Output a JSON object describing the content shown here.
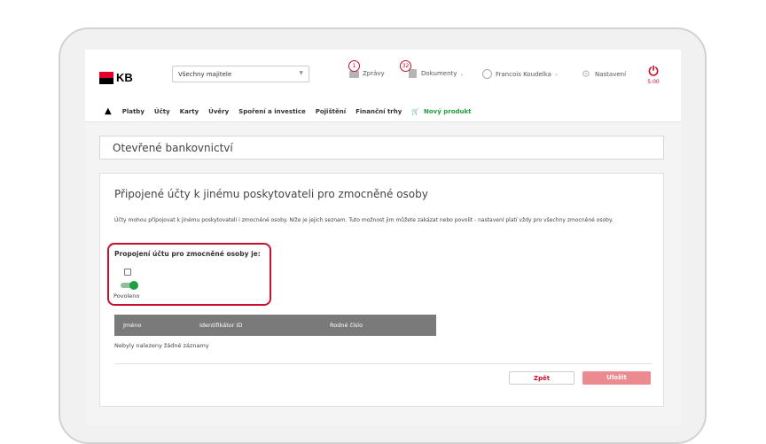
{
  "header": {
    "logo_text": "KB",
    "owner_select": {
      "value": "Všechny majitele"
    },
    "messages": {
      "label": "Zprávy",
      "badge": "1"
    },
    "documents": {
      "label": "Dokumenty",
      "badge": "32"
    },
    "user": {
      "label": "Francois Koudelka"
    },
    "settings": {
      "label": "Nastavení"
    },
    "session_time": "5:00"
  },
  "nav": {
    "items": [
      "Platby",
      "Účty",
      "Karty",
      "Úvěry",
      "Spoření a investice",
      "Pojištění",
      "Finanční trhy"
    ],
    "new_product": "Nový produkt"
  },
  "page_title": "Otevřené bankovnictví",
  "card": {
    "title": "Připojené účty k jinému poskytovateli pro zmocněné osoby",
    "description": "Účty mohou připojovat k jinému poskytovateli i zmocněné osoby. Níže je jejich seznam. Tuto možnost jim můžete zakázat nebo povolit - nastavení platí vždy pro všechny zmocněné osoby.",
    "toggle_label": "Propojení účtu pro zmocněné osoby je:",
    "toggle_state": "Povoleno",
    "toggle_on": true,
    "table_headers": [
      "Jméno",
      "Identifikátor ID",
      "Rodné číslo"
    ],
    "empty_message": "Nebyly nalezeny žádné záznamy",
    "back_button": "Zpět",
    "save_button": "Uložit"
  },
  "colors": {
    "brand_red": "#c8102e",
    "toggle_green": "#1e9e3e",
    "save_disabled": "#eb8a8f"
  }
}
